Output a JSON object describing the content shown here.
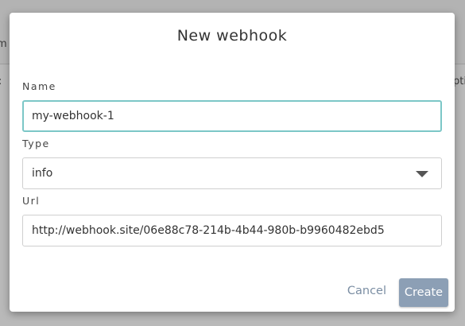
{
  "background": {
    "fragment_left_top": "m",
    "fragment_left_mid": ":",
    "fragment_right_mid": "pti"
  },
  "dialog": {
    "title": "New webhook",
    "fields": {
      "name": {
        "label": "Name",
        "value": "my-webhook-1",
        "focused": true
      },
      "type": {
        "label": "Type",
        "value": "info",
        "icon": "chevron-down-icon"
      },
      "url": {
        "label": "Url",
        "value": "http://webhook.site/06e88c78-214b-4b44-980b-b9960482ebd5"
      }
    },
    "buttons": {
      "cancel_label": "Cancel",
      "create_label": "Create"
    }
  },
  "colors": {
    "focus_border": "#7cc7c7",
    "create_button": "#8c9fb5",
    "cancel_text": "#7b8ea3",
    "overlay": "#b9b9b9"
  }
}
